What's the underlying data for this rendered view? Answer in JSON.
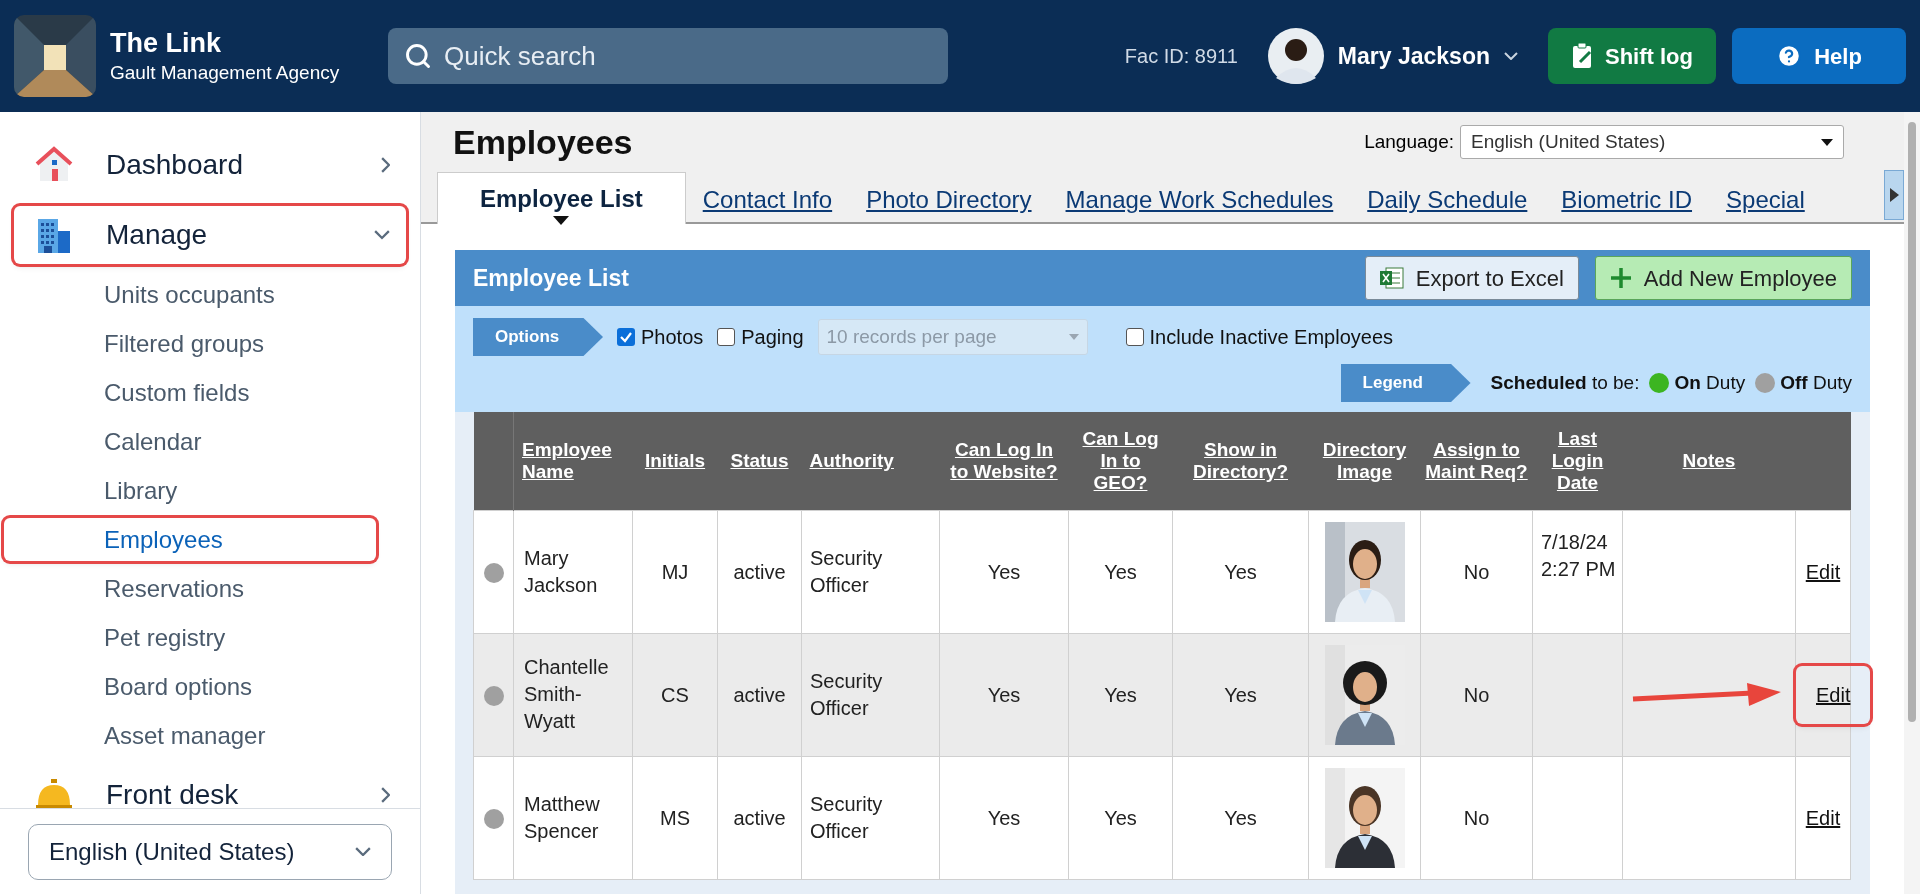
{
  "header": {
    "app_title": "The Link",
    "app_subtitle": "Gault Management Agency",
    "search": {
      "placeholder": "Quick search"
    },
    "fac_id": "Fac ID: 8911",
    "user": "Mary Jackson",
    "buttons": [
      {
        "kind": "shift",
        "label": "Shift log"
      },
      {
        "kind": "help",
        "label": "Help"
      }
    ]
  },
  "sidebar": {
    "items": [
      {
        "kind": "house",
        "label": "Dashboard",
        "expanded": false,
        "highlighted": false
      },
      {
        "kind": "building",
        "label": "Manage",
        "expanded": true,
        "highlighted": true,
        "children": [
          {
            "label": "Units occupants",
            "selected": false,
            "highlighted": false
          },
          {
            "label": "Filtered groups",
            "selected": false,
            "highlighted": false
          },
          {
            "label": "Custom fields",
            "selected": false,
            "highlighted": false
          },
          {
            "label": "Calendar",
            "selected": false,
            "highlighted": false
          },
          {
            "label": "Library",
            "selected": false,
            "highlighted": false
          },
          {
            "label": "Employees",
            "selected": true,
            "highlighted": true
          },
          {
            "label": "Reservations",
            "selected": false,
            "highlighted": false
          },
          {
            "label": "Pet registry",
            "selected": false,
            "highlighted": false
          },
          {
            "label": "Board options",
            "selected": false,
            "highlighted": false
          },
          {
            "label": "Asset manager",
            "selected": false,
            "highlighted": false
          }
        ]
      },
      {
        "kind": "bell",
        "label": "Front desk",
        "expanded": false,
        "highlighted": false
      }
    ],
    "language": "English (United States)"
  },
  "main": {
    "title": "Employees",
    "language_label": "Language:",
    "language_value": "English (United States)",
    "tabs": [
      {
        "label": "Employee List",
        "selected": true
      },
      {
        "label": "Contact Info",
        "selected": false
      },
      {
        "label": "Photo Directory",
        "selected": false
      },
      {
        "label": "Manage Work Schedules",
        "selected": false
      },
      {
        "label": "Daily Schedule",
        "selected": false
      },
      {
        "label": "Biometric ID",
        "selected": false
      },
      {
        "label": "Special",
        "selected": false
      }
    ],
    "panel": {
      "title": "Employee List",
      "buttons": [
        {
          "kind": "excel",
          "label": "Export to Excel"
        },
        {
          "kind": "add",
          "label": "Add New Employee"
        }
      ],
      "options": {
        "label": "Options",
        "photos": {
          "label": "Photos",
          "checked": true
        },
        "paging": {
          "label": "Paging",
          "checked": false
        },
        "per_page": {
          "value": "10 records per page",
          "disabled": true
        },
        "include_inactive": {
          "label": "Include Inactive Employees",
          "checked": false
        }
      },
      "legend": {
        "label": "Legend",
        "text": "**Scheduled** to be:",
        "items": [
          {
            "text": "**On** Duty",
            "color": "#3cb521"
          },
          {
            "text": "**Off** Duty",
            "color": "#a0a0a0"
          }
        ]
      },
      "table": {
        "columns": [
          "Employee Name",
          "Initials",
          "Status",
          "Authority",
          "Can Log In to Website?",
          "Can Log In to GEO?",
          "Show in Directory?",
          "Directory Image",
          "Assign to Maint Req?",
          "Last Login Date",
          "Notes"
        ],
        "rows": [
          {
            "color": "#a0a0a0",
            "name": "Mary Jackson",
            "initials": "MJ",
            "status": "active",
            "authority": "Security Officer",
            "website": "Yes",
            "geo": "Yes",
            "directory": "Yes",
            "maint": "No",
            "last_login": "7/18/24 2:27 PM",
            "edit": "Edit",
            "highlighted": false
          },
          {
            "color": "#a0a0a0",
            "name": "Chantelle Smith-Wyatt",
            "initials": "CS",
            "status": "active",
            "authority": "Security Officer",
            "website": "Yes",
            "geo": "Yes",
            "directory": "Yes",
            "maint": "No",
            "edit": "Edit",
            "highlighted": true
          },
          {
            "color": "#a0a0a0",
            "name": "Matthew Spencer",
            "initials": "MS",
            "status": "active",
            "authority": "Security Officer",
            "website": "Yes",
            "geo": "Yes",
            "directory": "Yes",
            "maint": "No",
            "edit": "Edit",
            "highlighted": false
          }
        ]
      }
    }
  }
}
